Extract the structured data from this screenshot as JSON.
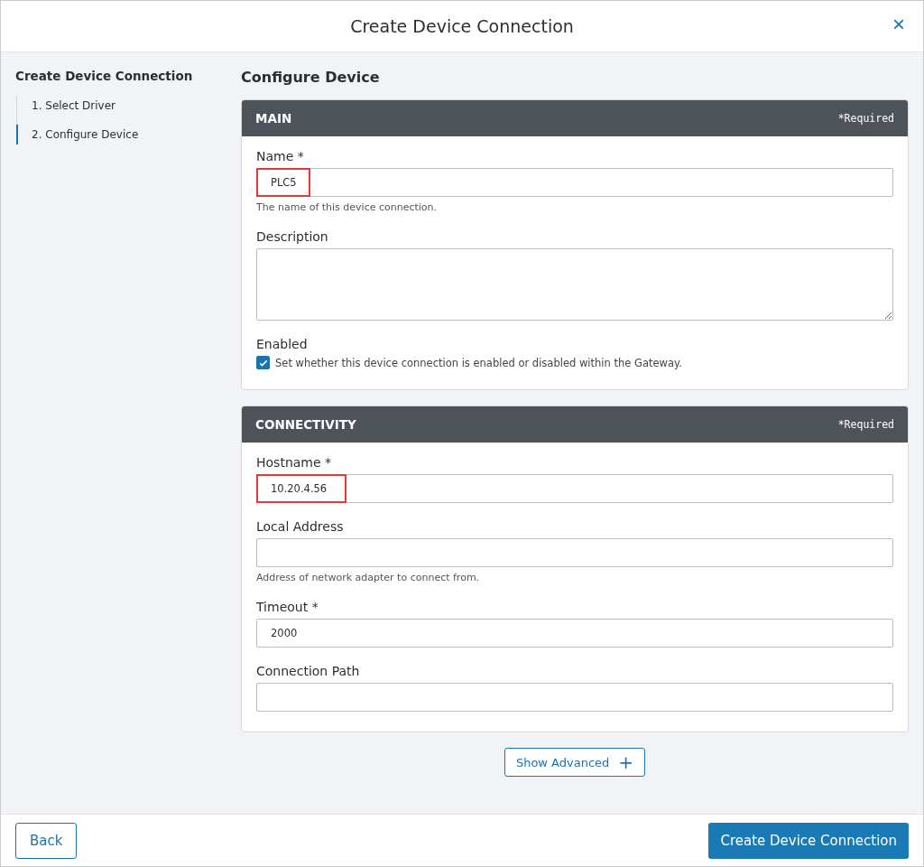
{
  "dialog": {
    "title": "Create Device Connection",
    "close_icon": "×"
  },
  "sidebar": {
    "title": "Create Device Connection",
    "steps": [
      {
        "label": "1. Select Driver",
        "selected": false
      },
      {
        "label": "2. Configure Device",
        "selected": true
      }
    ]
  },
  "main": {
    "heading": "Configure Device",
    "sections": [
      {
        "title": "MAIN",
        "required_note": "*Required",
        "fields": [
          {
            "kind": "text",
            "label": "Name *",
            "value": "PLC5",
            "help": "The name of this device connection.",
            "highlighted": true
          },
          {
            "kind": "textarea",
            "label": "Description",
            "highlighted": false
          },
          {
            "kind": "checkbox",
            "label": "Enabled",
            "checked": true,
            "text": "Set whether this device connection is enabled or disabled within the Gateway."
          }
        ]
      },
      {
        "title": "CONNECTIVITY",
        "required_note": "*Required",
        "fields": [
          {
            "kind": "text",
            "label": "Hostname *",
            "value": "10.20.4.56",
            "highlighted": true
          },
          {
            "kind": "text",
            "label": "Local Address",
            "help": "Address of network adapter to connect from.",
            "highlighted": false
          },
          {
            "kind": "text",
            "label": "Timeout *",
            "value": "2000",
            "highlighted": false
          },
          {
            "kind": "text",
            "label": "Connection Path",
            "highlighted": false
          }
        ]
      }
    ],
    "show_advanced": {
      "label": "Show Advanced",
      "icon": "+"
    }
  },
  "footer": {
    "back": "Back",
    "submit": "Create Device Connection"
  }
}
